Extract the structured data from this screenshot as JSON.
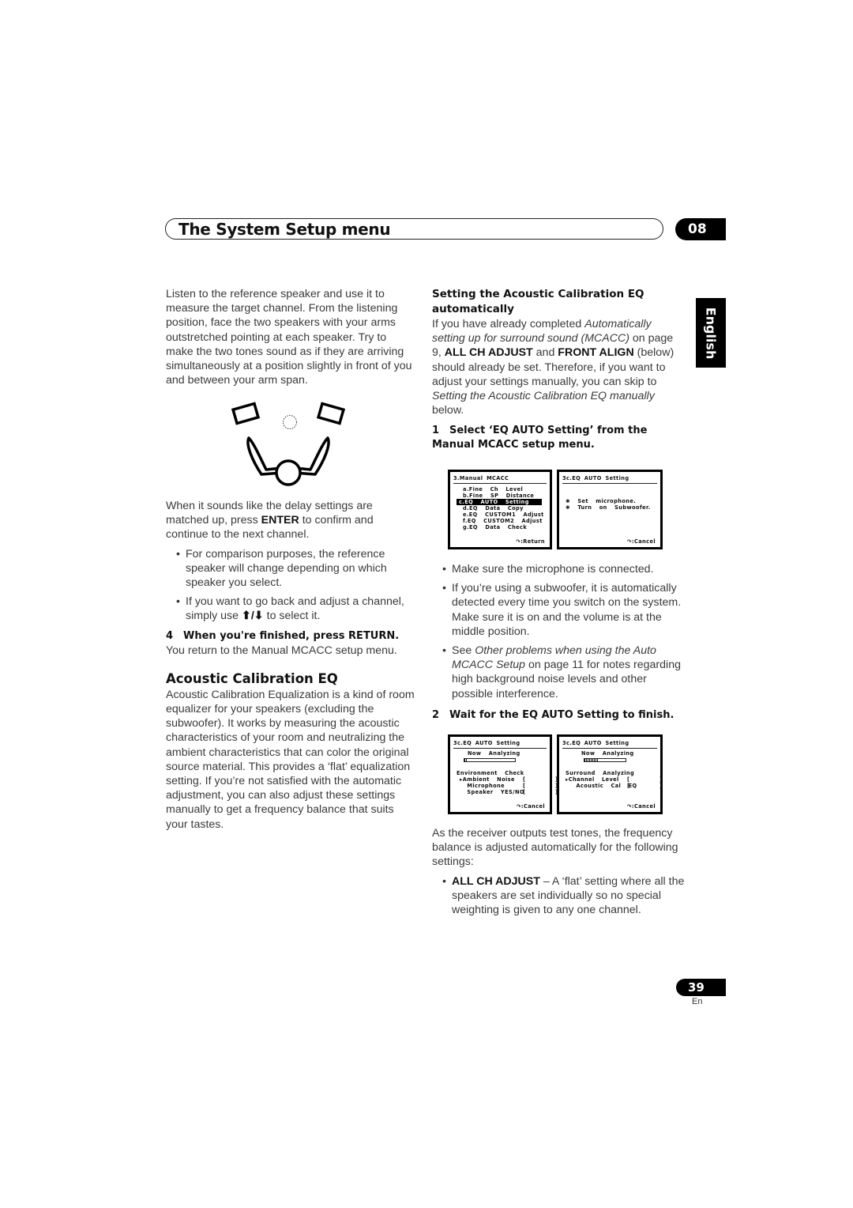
{
  "header": {
    "title": "The System Setup menu",
    "chapter": "08",
    "language_tab": "English"
  },
  "left_column": {
    "intro": "Listen to the reference speaker and use it to measure the target channel. From the listening position, face the two speakers with your arms outstretched pointing at each speaker. Try to make the two tones sound as if they are arriving simultaneously at a position slightly in front of you and between your arm span.",
    "diagram": {
      "icons": [
        "speaker-left-icon",
        "center-dotted-circle-icon",
        "speaker-right-icon",
        "listener-with-arms-icon"
      ]
    },
    "delay_para": {
      "before": "When it sounds like the delay settings are matched up, press ",
      "bold": "ENTER",
      "after": " to confirm and continue to the next channel."
    },
    "bullets": [
      "For comparison purposes, the reference speaker will change depending on which speaker you select.",
      {
        "before": "If you want to go back and adjust a channel, simply use ",
        "arrows": "⬆/⬇",
        "after": " to select it."
      }
    ],
    "step4": {
      "number": "4",
      "text": "When you're finished, press RETURN."
    },
    "step4_desc": "You return to the Manual MCACC setup menu.",
    "section_title": "Acoustic Calibration EQ",
    "section_body": "Acoustic Calibration Equalization is a kind of room equalizer for your speakers (excluding the subwoofer). It works by measuring the acoustic characteristics of your room and neutralizing the ambient characteristics that can color the original source material. This provides a ‘flat’ equalization setting. If you’re not satisfied with the automatic adjustment, you can also adjust these settings manually to get a frequency balance that suits your tastes."
  },
  "right_column": {
    "subhead": "Setting the Acoustic Calibration EQ automatically",
    "intro": {
      "t1": "If you have already completed ",
      "i1": "Automatically setting up for surround sound (MCACC)",
      "t2": " on page 9, ",
      "b1": "ALL CH ADJUST",
      "t3": " and ",
      "b2": "FRONT ALIGN",
      "t4": " (below) should already be set. Therefore, if you want to adjust your settings manually, you can skip to ",
      "i2": "Setting the Acoustic Calibration EQ manually",
      "t5": " below."
    },
    "step1": {
      "number": "1",
      "text": "Select ‘EQ AUTO Setting’ from the Manual MCACC setup menu."
    },
    "screens_row1": [
      {
        "title": "3.Manual  MCACC",
        "items": [
          "a.Fine  Ch  Level",
          "b.Fine  SP  Distance",
          "c.EQ  AUTO  Setting",
          "d.EQ  Data  Copy",
          "e.EQ  CUSTOM1  Adjust",
          "f.EQ  CUSTOM2  Adjust",
          "g.EQ  Data  Check"
        ],
        "selected_index": 2,
        "footer": "↷:Return"
      },
      {
        "title": "3c.EQ  AUTO  Setting",
        "items": [
          "✱  Set  microphone.",
          "✱  Turn  on  Subwoofer."
        ],
        "footer": "↷:Cancel"
      }
    ],
    "bullets": [
      "Make sure the microphone is connected.",
      "If you’re using a subwoofer, it is automatically detected every time you switch on the system. Make sure it is on and the volume is at the middle position.",
      {
        "t1": "See ",
        "i1": "Other problems when using the Auto MCACC Setup",
        "t2": " on page 11 for notes regarding high background noise levels and other possible interference."
      }
    ],
    "step2": {
      "number": "2",
      "text": "Wait for the EQ AUTO Setting to finish."
    },
    "screens_row2": [
      {
        "title": "3c.EQ  AUTO  Setting",
        "status": "Now  Analyzing",
        "progress": 0.05,
        "group": "Environment  Check",
        "rows": [
          {
            "label": "▸Ambient  Noise",
            "value": "[        ]"
          },
          {
            "label": "  Microphone",
            "value": "[        ]"
          },
          {
            "label": "  Speaker  YES/NO",
            "value": "[        ]"
          }
        ],
        "footer": "↷:Cancel"
      },
      {
        "title": "3c.EQ  AUTO  Setting",
        "status": "Now  Analyzing",
        "progress": 0.35,
        "group": "Surround  Analyzing",
        "rows": [
          {
            "label": "▸Channel  Level",
            "value": "[        ]"
          },
          {
            "label": "  Acoustic  Cal  EQ",
            "value": "[        ]"
          }
        ],
        "footer": "↷:Cancel"
      }
    ],
    "outro": "As the receiver outputs test tones, the frequency balance is adjusted automatically for the following settings:",
    "outro_bullet": {
      "bold": "ALL CH ADJUST",
      "text": " – A ‘flat’ setting where all the speakers are set individually so no special weighting is given to any one channel."
    }
  },
  "footer": {
    "page_number": "39",
    "language": "En"
  }
}
